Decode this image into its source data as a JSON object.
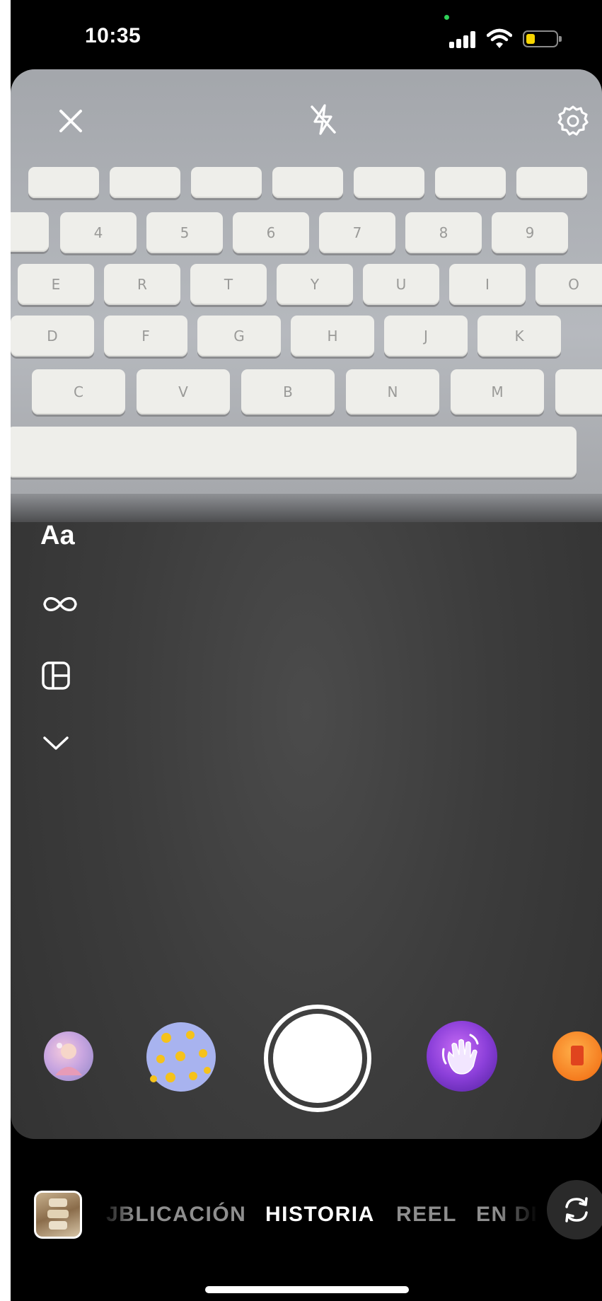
{
  "status_bar": {
    "time": "10:35"
  },
  "colors": {
    "battery_level": "#f7d500",
    "privacy_indicator": "#2fd158",
    "active_mode": "#ffffff",
    "inactive_mode": "#8e8e8e"
  },
  "battery": {
    "level_fraction": 0.3
  },
  "camera": {
    "top_controls": [
      "close-icon",
      "flash-off-icon",
      "settings-icon"
    ],
    "keyboard": {
      "row1": [
        "",
        "",
        "",
        "",
        "",
        "",
        "",
        ""
      ],
      "row2": [
        "4",
        "5",
        "6",
        "7",
        "8",
        "9"
      ],
      "row3": [
        "E",
        "R",
        "T",
        "Y",
        "U",
        "I",
        "O"
      ],
      "row4": [
        "D",
        "F",
        "G",
        "H",
        "J",
        "K"
      ],
      "row5": [
        "C",
        "V",
        "B",
        "N",
        "M"
      ]
    },
    "tools": {
      "text_label": "Aa",
      "boomerang_icon": "infinity-icon",
      "layout_icon": "layout-icon",
      "more_icon": "chevron-down-icon"
    },
    "effects": [
      "profile-effect",
      "dots-effect",
      "wave-hand-effect",
      "orange-effect"
    ]
  },
  "modes": {
    "items": [
      {
        "label": "PUBLICACIÓN",
        "visible_label": "JBLICACIÓN",
        "active": false
      },
      {
        "label": "HISTORIA",
        "active": true
      },
      {
        "label": "REEL",
        "active": false
      },
      {
        "label": "EN DIRECTO",
        "visible_label": "EN DI",
        "active": false
      }
    ]
  }
}
